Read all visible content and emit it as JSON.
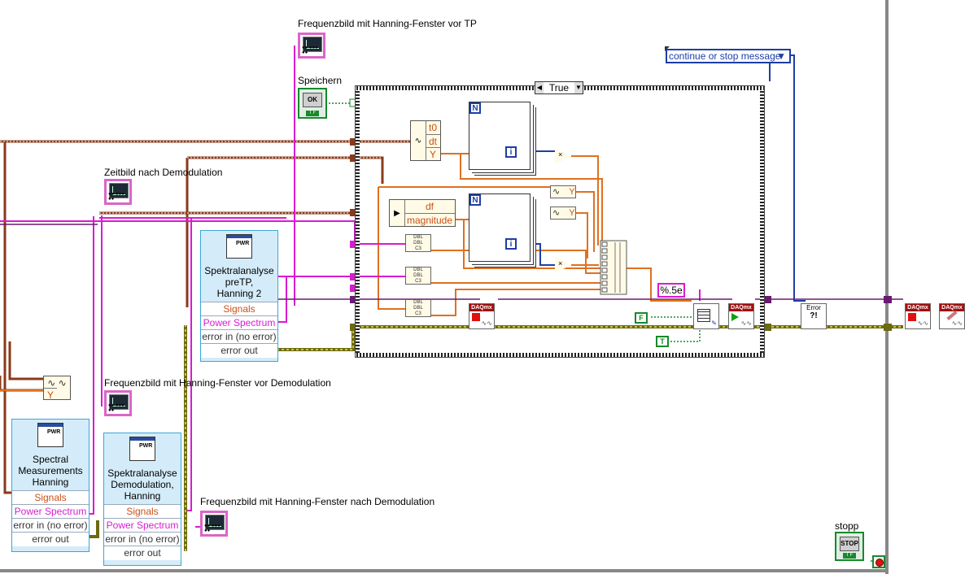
{
  "labels": {
    "top_indicator": "Frequenzbild mit Hanning-Fenster vor TP",
    "speichern": "Speichern",
    "zeitbild": "Zeitbild nach Demodulation",
    "freq_vor_demod": "Frequenzbild mit Hanning-Fenster vor Demodulation",
    "freq_nach_demod": "Frequenzbild mit Hanning-Fenster nach Demodulation",
    "stopp": "stopp"
  },
  "indicator_icon_text": "●● ●●● ●●",
  "case_selector": "True",
  "ring_control": "continue or stop message",
  "format_string": "%.5e",
  "constants": {
    "false": "F",
    "true": "T"
  },
  "buttons": {
    "ok": "OK",
    "stop": "STOP",
    "tf": "T F"
  },
  "express_vis": [
    {
      "title": [
        "Spektralanalyse",
        "preTP,",
        "Hanning 2"
      ],
      "terms": [
        "Signals",
        "Power Spectrum",
        "error in (no error)",
        "error out"
      ]
    },
    {
      "title": [
        "Spectral",
        "Measurements",
        "Hanning"
      ],
      "terms": [
        "Signals",
        "Power Spectrum",
        "error in (no error)",
        "error out"
      ]
    },
    {
      "title": [
        "Spektralanalyse",
        "Demodulation,",
        "Hanning"
      ],
      "terms": [
        "Signals",
        "Power Spectrum",
        "error in (no error)",
        "error out"
      ]
    }
  ],
  "express_icon": "PWR",
  "unbundle_t": [
    "t0",
    "dt",
    "Y"
  ],
  "unbundle_f": [
    "df",
    "magnitude"
  ],
  "y_node": "Y",
  "loop": {
    "n": "N",
    "i": "i"
  },
  "mult_symbol": "×",
  "dbl_text": [
    "DBL",
    "DBL",
    "C3"
  ],
  "daq_header": "DAQmx",
  "error_handler": [
    "Error",
    "?!"
  ]
}
